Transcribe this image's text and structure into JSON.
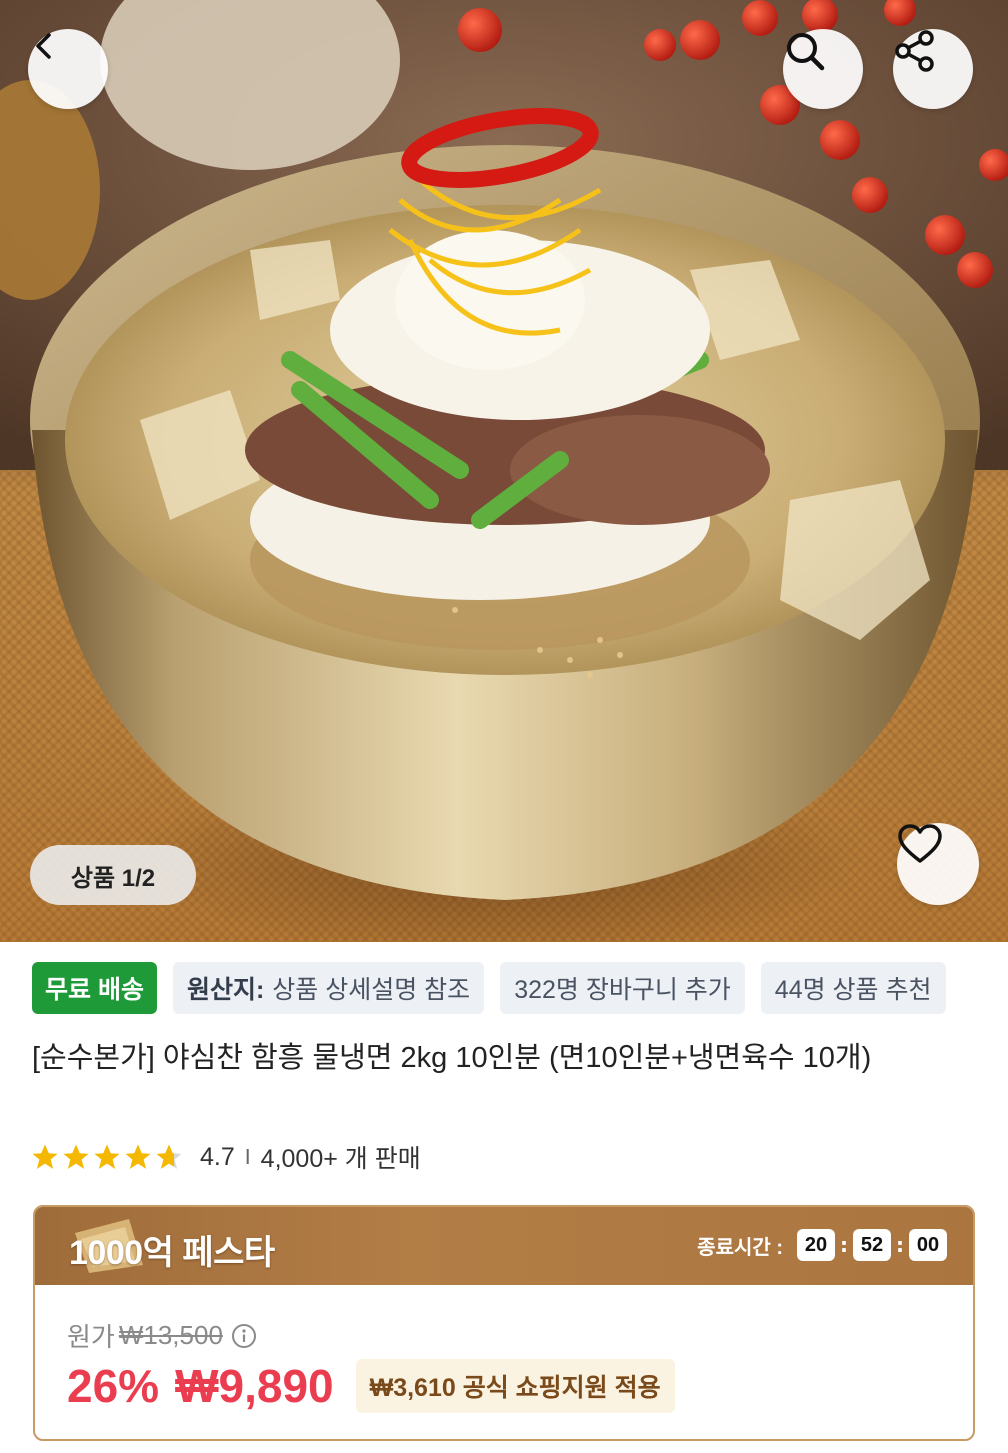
{
  "hero": {
    "image_description": "",
    "counter": "상품 1/2",
    "icons": {
      "back": "chevron-left-icon",
      "search": "search-icon",
      "share": "share-icon",
      "wishlist": "heart-icon"
    }
  },
  "tags": {
    "free_shipping": "무료 배송",
    "origin_label": "원산지:",
    "origin_value": "상품 상세설명 참조",
    "cart_count": "322명 장바구니 추가",
    "recommend": "44명 상품 추천"
  },
  "product": {
    "title": "[순수본가] 야심찬 함흥 물냉면 2kg 10인분 (면10인분+냉면육수 10개)",
    "rating": "4.7",
    "rating_separator": "I",
    "sold": "4,000+ 개 판매",
    "stars_filled": 4.7
  },
  "promo": {
    "title": "1000억 페스타",
    "timer_label": "종료시간 :",
    "hours": "20",
    "minutes": "52",
    "seconds": "00",
    "original_label": "원가",
    "original_price": "₩13,500",
    "discount": "26%",
    "price": "₩9,890",
    "support_text": "₩3,610 공식 쇼핑지원 적용"
  },
  "colors": {
    "free_shipping_bg": "#1f9a39",
    "discount_red": "#ea3d4f",
    "promo_brown": "#a9743f",
    "star_yellow": "#f5b800"
  }
}
